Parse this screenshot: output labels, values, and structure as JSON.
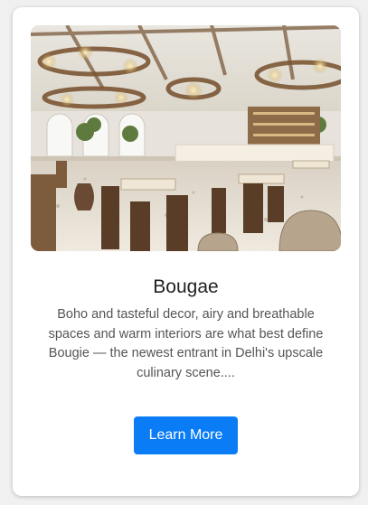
{
  "card": {
    "title": "Bougae",
    "description": "Boho and tasteful decor, airy and breathable spaces and warm interiors are what best define Bougie — the newest entrant in Delhi's upscale culinary scene....",
    "button_label": "Learn More",
    "image_subject": "restaurant interior with rattan chandeliers, bar counter and wooden dining chairs"
  },
  "colors": {
    "page_background": "#f0f0f0",
    "card_background": "#ffffff",
    "title_text": "#222222",
    "description_text": "#555555",
    "button_background": "#0a7cf6",
    "button_text": "#ffffff"
  }
}
